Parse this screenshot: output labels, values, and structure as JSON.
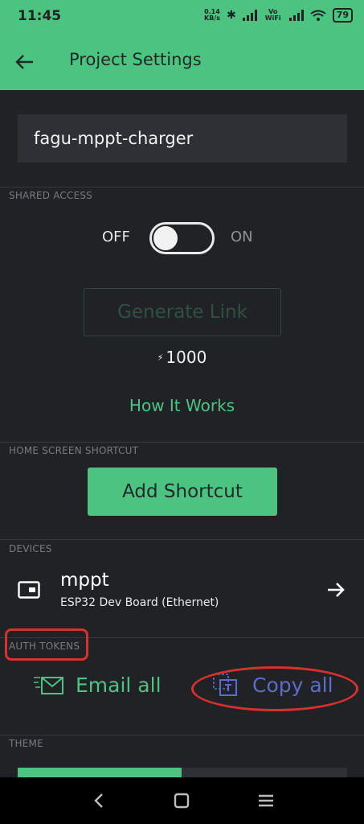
{
  "status_bar": {
    "time": "11:45",
    "net_speed_value": "0.14",
    "net_speed_unit": "KB/s",
    "volte": "Vo WiFi",
    "battery": "79"
  },
  "app_bar": {
    "title": "Project Settings"
  },
  "project_name": "fagu-mppt-charger",
  "shared_access": {
    "section_label": "SHARED ACCESS",
    "toggle_off_label": "OFF",
    "toggle_on_label": "ON",
    "toggle_state": "off",
    "generate_link_label": "Generate Link",
    "energy_cost": "1000",
    "how_it_works_label": "How It Works"
  },
  "home_screen_shortcut": {
    "section_label": "HOME SCREEN SHORTCUT",
    "add_shortcut_label": "Add Shortcut"
  },
  "devices": {
    "section_label": "DEVICES",
    "items": [
      {
        "name": "mppt",
        "type": "ESP32 Dev Board (Ethernet)"
      }
    ]
  },
  "auth_tokens": {
    "section_label": "AUTH TOKENS",
    "email_all_label": "Email all",
    "copy_all_label": "Copy all"
  },
  "theme": {
    "section_label": "THEME"
  },
  "colors": {
    "accent": "#4dc381",
    "background": "#202226",
    "annotation": "#d8312c",
    "copy_all": "#5c6cc9"
  },
  "icons": {
    "back": "arrow-left-icon",
    "energy": "lightning-icon",
    "device": "board-icon",
    "device_open": "arrow-right-icon",
    "email_all": "email-icon",
    "copy_all": "copy-icon"
  }
}
